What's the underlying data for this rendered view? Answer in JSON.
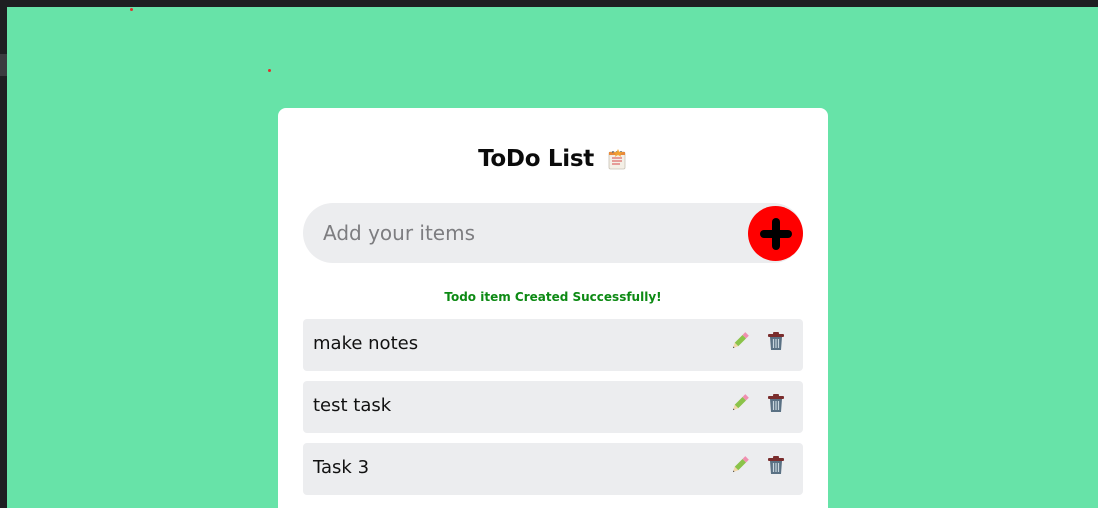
{
  "app": {
    "title": "ToDo List",
    "title_icon": "notepad-icon",
    "accent_color": "#ff0000",
    "background_color": "#67e3a8"
  },
  "input": {
    "placeholder": "Add your items",
    "value": "",
    "add_icon": "plus-icon"
  },
  "status": {
    "message": "Todo item Created Successfully!",
    "color": "#0d8a14"
  },
  "items": [
    {
      "label": "make notes",
      "edit_icon": "pencil-icon",
      "delete_icon": "trash-icon"
    },
    {
      "label": "test task",
      "edit_icon": "pencil-icon",
      "delete_icon": "trash-icon"
    },
    {
      "label": "Task 3",
      "edit_icon": "pencil-icon",
      "delete_icon": "trash-icon"
    }
  ]
}
